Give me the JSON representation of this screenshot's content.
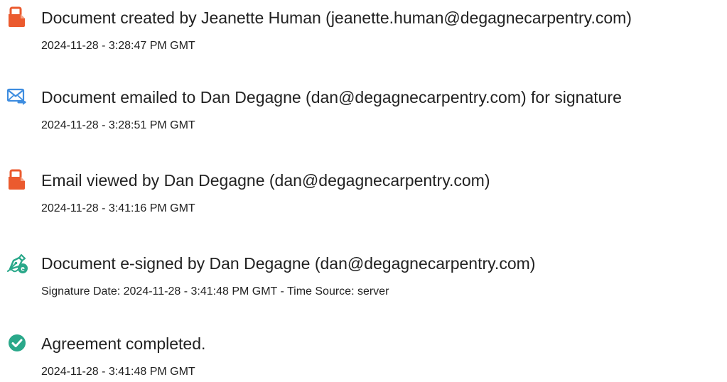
{
  "colors": {
    "doc_icon": "#EB5A2E",
    "email_icon": "#3E8DE0",
    "sign_icon": "#2AA88A",
    "complete_icon": "#2AA88A"
  },
  "events": [
    {
      "icon": "document-icon",
      "title": "Document created by Jeanette Human (jeanette.human@degagnecarpentry.com)",
      "detail": "2024-11-28 - 3:28:47 PM GMT"
    },
    {
      "icon": "email-icon",
      "title": "Document emailed to Dan Degagne (dan@degagnecarpentry.com) for signature",
      "detail": "2024-11-28 - 3:28:51 PM GMT"
    },
    {
      "icon": "document-icon",
      "title": "Email viewed by Dan Degagne (dan@degagnecarpentry.com)",
      "detail": "2024-11-28 - 3:41:16 PM GMT"
    },
    {
      "icon": "esign-pen-icon",
      "title": "Document e-signed by Dan Degagne (dan@degagnecarpentry.com)",
      "detail": "Signature Date: 2024-11-28 - 3:41:48 PM GMT - Time Source: server"
    },
    {
      "icon": "checkmark-circle-icon",
      "title": "Agreement completed.",
      "detail": "2024-11-28 - 3:41:48 PM GMT"
    }
  ]
}
